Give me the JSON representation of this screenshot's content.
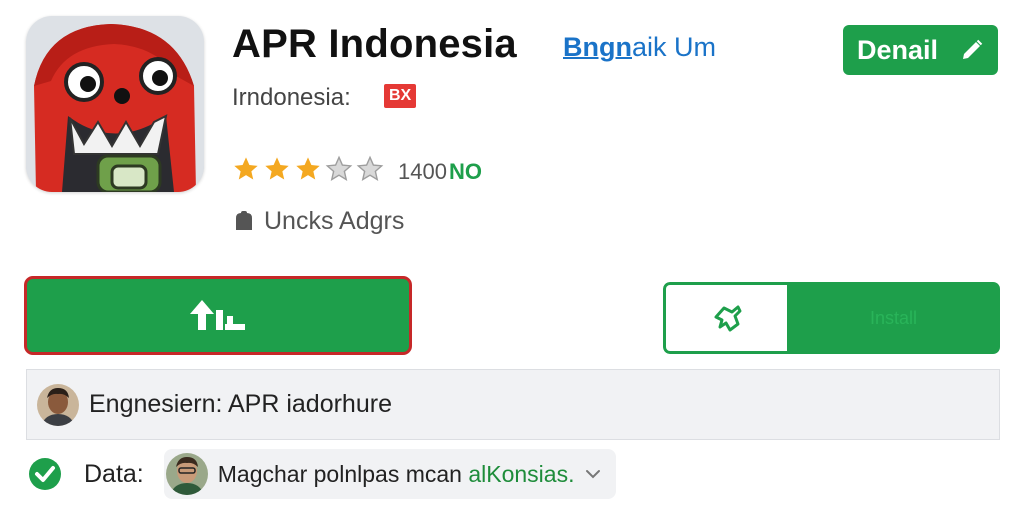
{
  "app": {
    "title": "APR Indonesia",
    "title_link_first": "Bngn",
    "title_link_rest": "aik Um",
    "subtitle": "Irndonesia:",
    "country_badge": "BX",
    "rating_stars": 3,
    "rating_max": 5,
    "rating_count": "1400",
    "rating_count_suffix": "NO",
    "ads_label": "Uncks Adgrs"
  },
  "header": {
    "detail_button_label": "Denail"
  },
  "actions": {
    "install_icon": "upload-arrows-icon",
    "secondary_icon": "pin-icon",
    "secondary_label": "Install"
  },
  "developer": {
    "text": "Engnesiern: APR iadorhure"
  },
  "data_row": {
    "label": "Data:",
    "chip_text": "Magchar polnlpas mcan ",
    "chip_highlight": "alKonsias."
  },
  "colors": {
    "brand_green": "#1e9f4b",
    "danger_red": "#c62828",
    "link_blue": "#1a73c8",
    "star_gold": "#f4a820"
  }
}
